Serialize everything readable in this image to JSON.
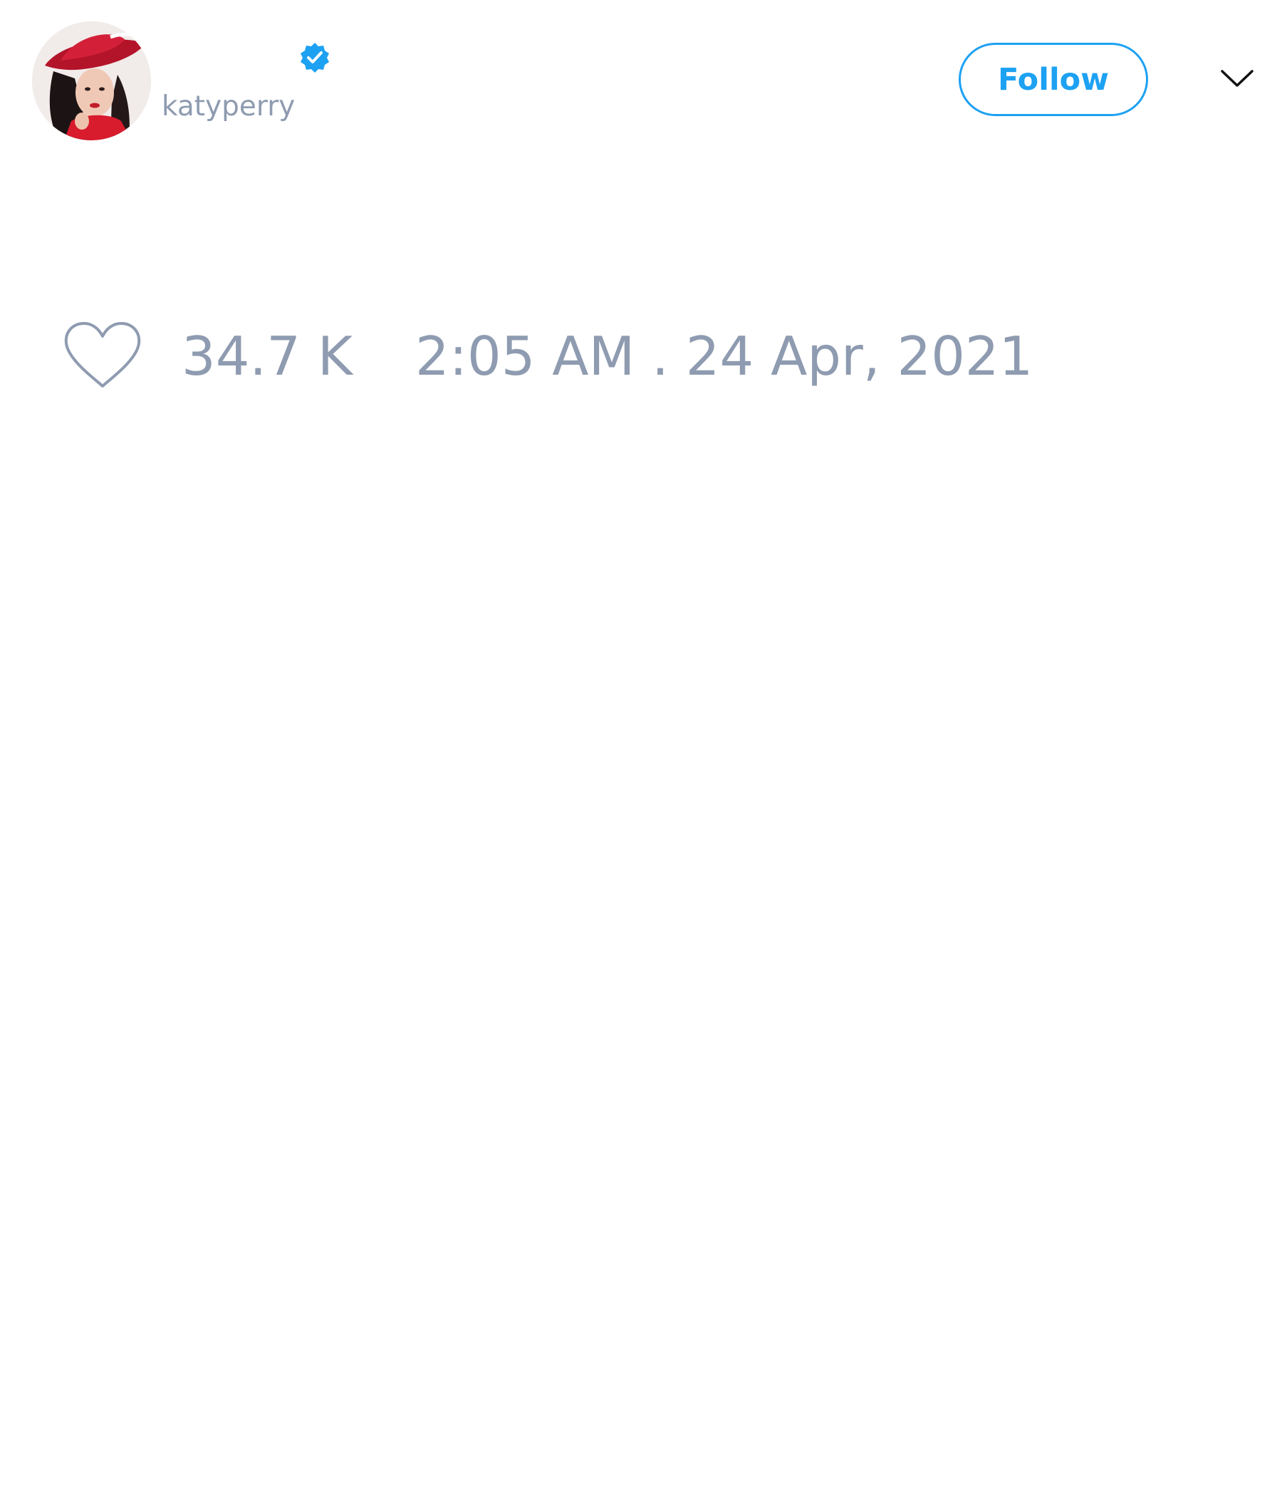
{
  "tweet": {
    "author": {
      "username": "katyperry",
      "verified": true,
      "avatar_icon": "profile-photo"
    },
    "follow_button_label": "Follow",
    "more_menu_icon": "chevron-down-icon",
    "likes": {
      "icon": "heart-icon",
      "count": "34.7 K"
    },
    "timestamp": "2:05 AM . 24 Apr, 2021"
  },
  "colors": {
    "accent": "#1da1f2",
    "muted_text": "#8e9bb0",
    "background": "#ffffff"
  }
}
